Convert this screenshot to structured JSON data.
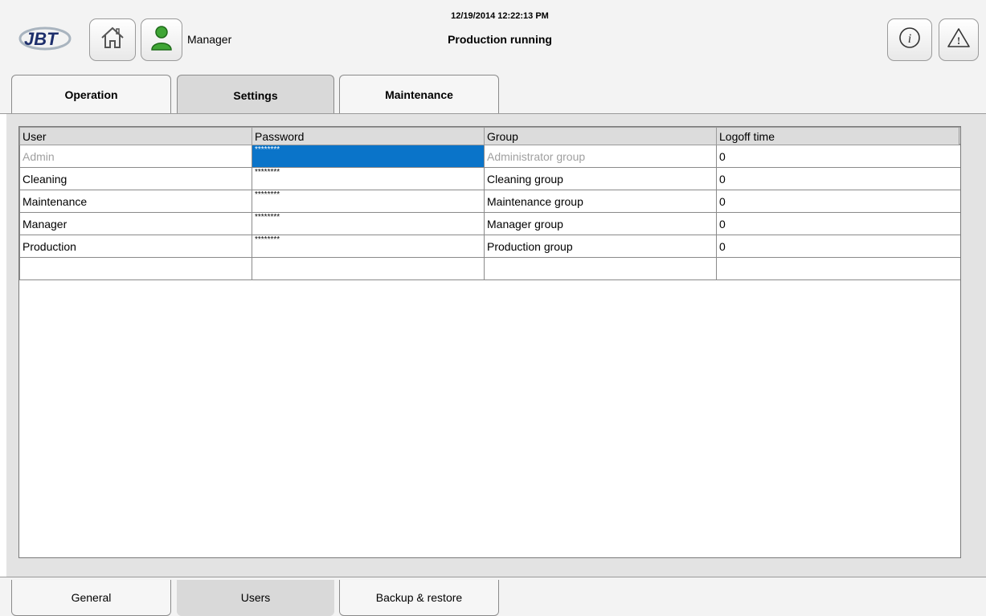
{
  "header": {
    "logo_text": "JBT",
    "username": "Manager",
    "datetime": "12/19/2014 12:22:13 PM",
    "status": "Production running"
  },
  "tabs": [
    {
      "label": "Operation",
      "active": false
    },
    {
      "label": "Settings",
      "active": true
    },
    {
      "label": "Maintenance",
      "active": false
    }
  ],
  "users_table": {
    "columns": [
      "User",
      "Password",
      "Group",
      "Logoff time"
    ],
    "rows": [
      {
        "user": "Admin",
        "password": "********",
        "group": "Administrator group",
        "logoff": "0"
      },
      {
        "user": "Cleaning",
        "password": "********",
        "group": "Cleaning group",
        "logoff": "0"
      },
      {
        "user": "Maintenance",
        "password": "********",
        "group": "Maintenance group",
        "logoff": "0"
      },
      {
        "user": "Manager",
        "password": "********",
        "group": "Manager group",
        "logoff": "0"
      },
      {
        "user": "Production",
        "password": "********",
        "group": "Production group",
        "logoff": "0"
      },
      {
        "user": "",
        "password": "",
        "group": "",
        "logoff": ""
      }
    ]
  },
  "bottom_tabs": [
    {
      "label": "General",
      "active": false
    },
    {
      "label": "Users",
      "active": true
    },
    {
      "label": "Backup & restore",
      "active": false
    }
  ],
  "colors": {
    "selection": "#0a74c9",
    "user_icon": "#3fa535"
  },
  "icons": [
    "home-icon",
    "user-icon",
    "info-icon",
    "warning-icon"
  ]
}
